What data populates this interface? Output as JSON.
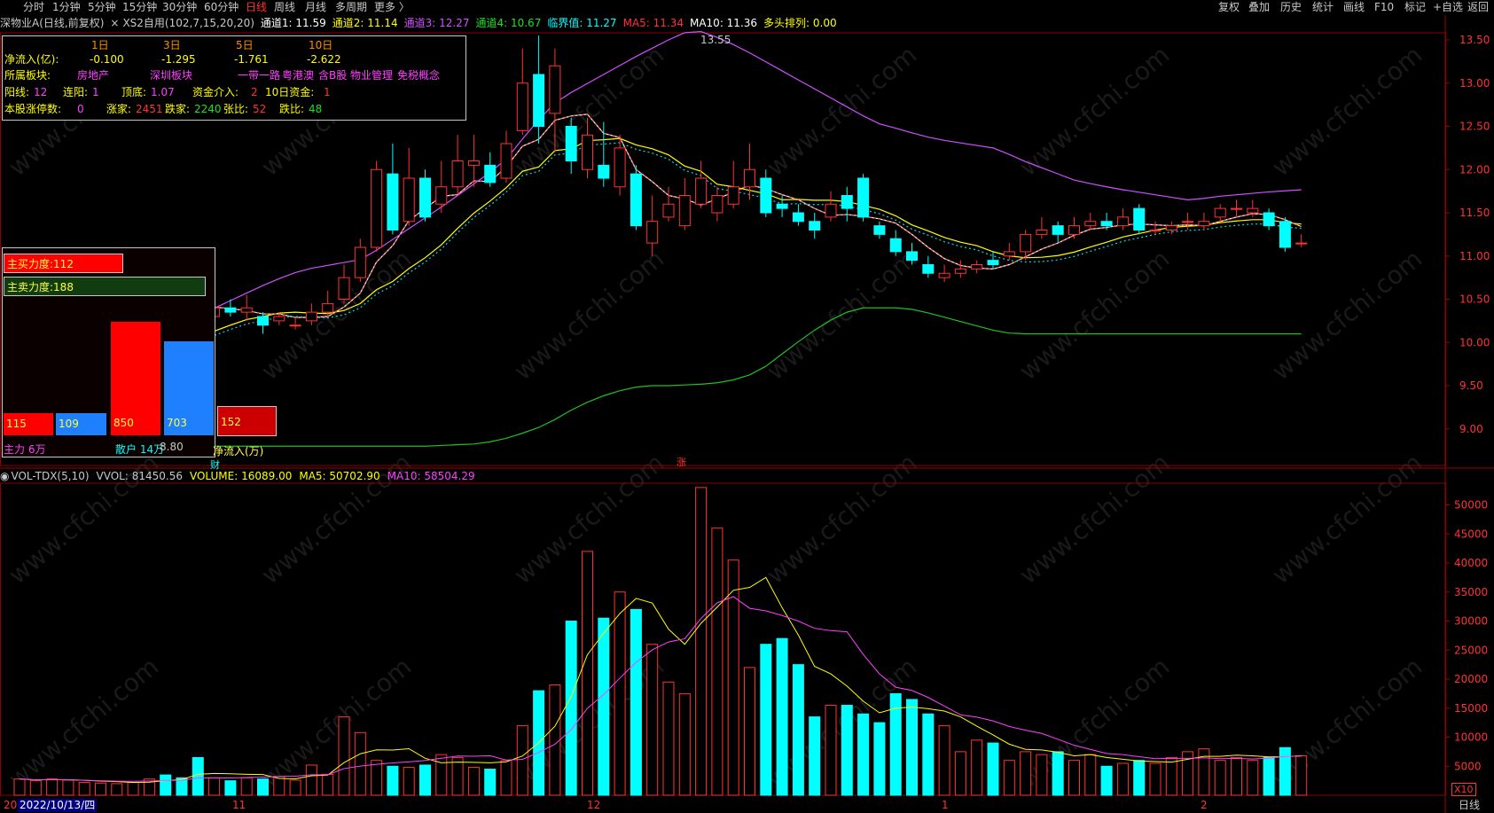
{
  "toolbar": {
    "periods": [
      "分时",
      "1分钟",
      "5分钟",
      "15分钟",
      "30分钟",
      "60分钟",
      "日线",
      "周线",
      "月线",
      "多周期",
      "更多 〉"
    ],
    "active_period": "日线",
    "right_buttons": [
      "复权",
      "叠加",
      "历史",
      "统计",
      "画线",
      "F10",
      "标记",
      "+自选",
      "返回"
    ]
  },
  "info_bar": {
    "stock": "深物业A(日线,前复权)",
    "close_icon": "×",
    "indicator": "XS2自用(102,7,15,20,20)",
    "ch1": "通道1: 11.59",
    "ch2": "通道2: 11.14",
    "ch3": "通道3: 12.27",
    "ch4": "通道4: 10.67",
    "lj": "临界值: 11.27",
    "ma5": "MA5: 11.34",
    "ma10": "MA10: 11.36",
    "dt": "多头排列: 0.00"
  },
  "info_panel": {
    "periods": [
      "1日",
      "3日",
      "5日",
      "10日"
    ],
    "net_inflow_label": "净流入(亿):",
    "net_inflow": [
      "-0.100",
      "-1.295",
      "-1.761",
      "-2.622"
    ],
    "sector_label": "所属板块:",
    "sectors": [
      "房地产",
      "深圳板块",
      "一带一路",
      "粤港澳",
      "含B股",
      "物业管理",
      "免税概念"
    ],
    "yang_label": "阳线:",
    "yang": "12",
    "lianyang_label": "连阳:",
    "lianyang": "1",
    "dingdi_label": "顶底:",
    "dingdi": "1.07",
    "zijin_label": "资金介入:",
    "zijin": "2",
    "zijin10_label": "10日资金:",
    "zijin10": "1",
    "zt_label": "本股涨停数:",
    "zt": "0",
    "zhangjia_label": "涨家:",
    "zhangjia": "2451",
    "diejia_label": "跌家:",
    "diejia": "2240",
    "zhangbi_label": "张比:",
    "zhangbi": "52",
    "diebi_label": "跌比:",
    "diebi": "48"
  },
  "money_flow": {
    "buy_label": "主买力度:112",
    "sell_label": "主卖力度:188",
    "bars": [
      {
        "value": "115",
        "color": "#ff0000"
      },
      {
        "value": "109",
        "color": "#1e7fff"
      },
      {
        "value": "850",
        "color": "#ff0000"
      },
      {
        "value": "703",
        "color": "#1e7fff"
      }
    ],
    "net": "152",
    "main_label": "主力 6万",
    "retail_label": "散户 14万",
    "net_label": "净流入(万)",
    "cai": "财",
    "zhang": "涨"
  },
  "price_axis": [
    "13.50",
    "13.00",
    "12.50",
    "12.00",
    "11.50",
    "11.00",
    "10.50",
    "10.00",
    "9.50",
    "9.00"
  ],
  "price_annotations": {
    "high": "13.55",
    "low": "8.80"
  },
  "volume_info": {
    "name": "VOL-TDX(5,10)",
    "vvol": "VVOL: 81450.56",
    "volume": "VOLUME: 16089.00",
    "ma5": "MA5: 50702.90",
    "ma10": "MA10: 58504.29"
  },
  "volume_axis": [
    "50000",
    "45000",
    "40000",
    "35000",
    "30000",
    "25000",
    "20000",
    "15000",
    "10000",
    "5000"
  ],
  "vol_unit": "X10",
  "date_axis": {
    "cursor": "2022/10/13/四",
    "left_prefix": "20",
    "months": [
      "11",
      "12",
      "1",
      "2"
    ],
    "period_label": "日线"
  },
  "colors": {
    "up": "#ff3232",
    "down": "#00ffff",
    "ma_white": "#ffffff",
    "ma_yellow": "#ffff00",
    "ch3": "#d050ff",
    "ch4": "#20c020",
    "watermark": "#1c1c1c"
  },
  "chart_data": {
    "type": "candlestick",
    "price_ylim": [
      8.8,
      13.55
    ],
    "candles": [
      [
        9.45,
        9.5,
        9.65,
        9.4
      ],
      [
        9.5,
        9.55,
        9.75,
        9.45
      ],
      [
        9.55,
        9.6,
        9.7,
        9.45
      ],
      [
        9.55,
        9.65,
        9.75,
        9.45
      ],
      [
        9.65,
        9.75,
        9.85,
        9.55
      ],
      [
        9.75,
        9.85,
        9.95,
        9.65
      ],
      [
        9.85,
        9.9,
        10.0,
        9.75
      ],
      [
        9.95,
        10.1,
        10.2,
        9.85
      ],
      [
        10.1,
        10.45,
        10.5,
        10.0
      ],
      [
        10.65,
        10.5,
        10.8,
        10.4
      ],
      [
        10.5,
        10.4,
        10.6,
        10.3
      ],
      [
        10.4,
        10.3,
        10.5,
        10.2
      ],
      [
        10.3,
        10.4,
        10.5,
        10.25
      ],
      [
        10.4,
        10.35,
        10.5,
        10.3
      ],
      [
        10.35,
        10.4,
        10.55,
        10.25
      ],
      [
        10.3,
        10.2,
        10.35,
        10.1
      ],
      [
        10.25,
        10.3,
        10.35,
        10.2
      ],
      [
        10.2,
        10.2,
        10.3,
        10.15
      ],
      [
        10.25,
        10.35,
        10.45,
        10.2
      ],
      [
        10.35,
        10.45,
        10.6,
        10.3
      ],
      [
        10.5,
        10.75,
        10.9,
        10.45
      ],
      [
        10.75,
        11.1,
        11.2,
        10.7
      ],
      [
        11.1,
        12.0,
        12.1,
        11.05
      ],
      [
        11.95,
        11.3,
        12.3,
        11.25
      ],
      [
        11.4,
        11.9,
        12.25,
        11.35
      ],
      [
        11.9,
        11.45,
        12.0,
        11.4
      ],
      [
        11.6,
        11.8,
        12.1,
        11.5
      ],
      [
        11.8,
        12.1,
        12.4,
        11.7
      ],
      [
        12.05,
        12.1,
        12.4,
        11.8
      ],
      [
        12.05,
        11.85,
        12.2,
        11.8
      ],
      [
        11.9,
        12.3,
        12.45,
        11.85
      ],
      [
        12.45,
        13.0,
        13.4,
        12.4
      ],
      [
        13.1,
        12.5,
        13.55,
        12.3
      ],
      [
        12.65,
        13.2,
        13.4,
        12.2
      ],
      [
        12.5,
        12.1,
        12.6,
        11.95
      ],
      [
        12.0,
        12.4,
        12.6,
        11.9
      ],
      [
        12.05,
        11.9,
        12.55,
        11.8
      ],
      [
        11.8,
        12.25,
        12.4,
        11.7
      ],
      [
        11.95,
        11.35,
        12.05,
        11.3
      ],
      [
        11.15,
        11.4,
        11.7,
        11.0
      ],
      [
        11.45,
        11.6,
        11.8,
        11.4
      ],
      [
        11.35,
        11.7,
        11.9,
        11.3
      ],
      [
        11.6,
        11.9,
        12.1,
        11.55
      ],
      [
        11.5,
        11.7,
        11.8,
        11.4
      ],
      [
        11.6,
        11.8,
        12.1,
        11.55
      ],
      [
        11.8,
        12.0,
        12.3,
        11.65
      ],
      [
        11.9,
        11.5,
        12.0,
        11.45
      ],
      [
        11.6,
        11.55,
        11.7,
        11.45
      ],
      [
        11.5,
        11.4,
        11.6,
        11.35
      ],
      [
        11.4,
        11.3,
        11.5,
        11.2
      ],
      [
        11.45,
        11.6,
        11.75,
        11.4
      ],
      [
        11.7,
        11.55,
        11.8,
        11.4
      ],
      [
        11.9,
        11.45,
        11.95,
        11.4
      ],
      [
        11.35,
        11.25,
        11.4,
        11.2
      ],
      [
        11.2,
        11.05,
        11.3,
        11.0
      ],
      [
        11.05,
        10.95,
        11.15,
        10.9
      ],
      [
        10.9,
        10.8,
        11.0,
        10.75
      ],
      [
        10.75,
        10.8,
        10.9,
        10.7
      ],
      [
        10.8,
        10.85,
        10.95,
        10.75
      ],
      [
        10.85,
        10.9,
        10.95,
        10.8
      ],
      [
        10.95,
        10.9,
        11.05,
        10.85
      ],
      [
        11.0,
        11.05,
        11.15,
        10.95
      ],
      [
        11.05,
        11.25,
        11.3,
        10.95
      ],
      [
        11.25,
        11.3,
        11.45,
        11.2
      ],
      [
        11.35,
        11.25,
        11.4,
        11.15
      ],
      [
        11.25,
        11.35,
        11.45,
        11.2
      ],
      [
        11.35,
        11.4,
        11.5,
        11.3
      ],
      [
        11.4,
        11.35,
        11.5,
        11.3
      ],
      [
        11.35,
        11.45,
        11.55,
        11.3
      ],
      [
        11.55,
        11.3,
        11.6,
        11.25
      ],
      [
        11.3,
        11.3,
        11.4,
        11.25
      ],
      [
        11.3,
        11.35,
        11.4,
        11.25
      ],
      [
        11.4,
        11.4,
        11.5,
        11.3
      ],
      [
        11.35,
        11.4,
        11.5,
        11.3
      ],
      [
        11.45,
        11.55,
        11.6,
        11.4
      ],
      [
        11.55,
        11.55,
        11.65,
        11.45
      ],
      [
        11.5,
        11.55,
        11.65,
        11.45
      ],
      [
        11.5,
        11.35,
        11.55,
        11.3
      ],
      [
        11.4,
        11.1,
        11.45,
        11.05
      ],
      [
        11.15,
        11.15,
        11.25,
        11.1
      ]
    ],
    "volume_ylim": [
      0,
      55000
    ],
    "volumes": [
      2800,
      2500,
      2800,
      2600,
      2200,
      2100,
      2000,
      2200,
      2800,
      3500,
      3000,
      6500,
      3000,
      2500,
      3000,
      2800,
      3200,
      2600,
      5200,
      3600,
      13500,
      10800,
      6000,
      5000,
      4800,
      5200,
      7000,
      6500,
      4800,
      4500,
      6000,
      12000,
      18000,
      19000,
      30000,
      42000,
      30500,
      35000,
      32000,
      26000,
      19500,
      17500,
      53000,
      46000,
      40500,
      22000,
      26000,
      27000,
      22500,
      13500,
      15500,
      15500,
      14000,
      12500,
      17500,
      16500,
      14000,
      12000,
      7500,
      9500,
      9000,
      6000,
      7500,
      7000,
      7500,
      6000,
      7000,
      5000,
      5500,
      6000,
      5500,
      6500,
      7500,
      8000,
      6000,
      6500,
      6000,
      6500,
      8200,
      6800
    ]
  }
}
